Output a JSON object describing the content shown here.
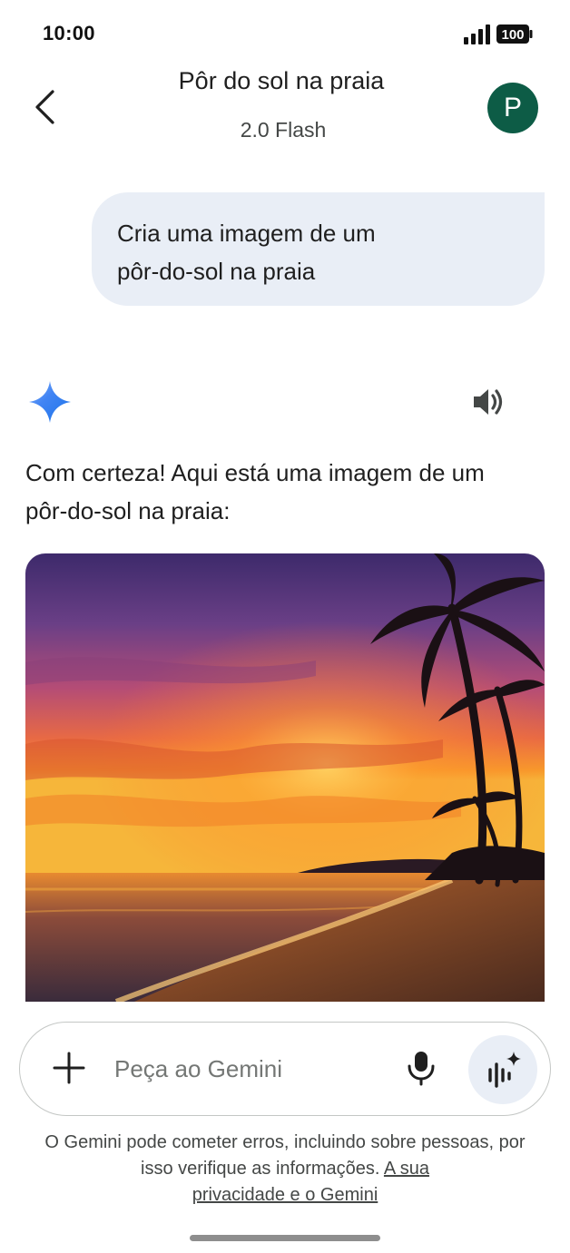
{
  "status_bar": {
    "time": "10:00",
    "battery": "100"
  },
  "header": {
    "title": "Pôr do sol na praia",
    "model": "2.0 Flash",
    "avatar_initial": "P"
  },
  "user_message": {
    "line1": "Cria uma imagem de um",
    "line2": "pôr-do-sol na praia"
  },
  "response": {
    "line1": "Com certeza! Aqui está uma imagem de um",
    "line2": "pôr-do-sol na praia:"
  },
  "input": {
    "placeholder": "Peça ao Gemini"
  },
  "footer": {
    "disclaimer_part1": "O Gemini pode cometer erros, incluindo sobre",
    "disclaimer_part2": "pessoas, por isso verifique as informações.",
    "privacy_link_part1": "A sua",
    "privacy_link_part2": "privacidade e o Gemini"
  },
  "colors": {
    "avatar": "#0d5c46",
    "bubble": "#e9eef6",
    "accent_blue": "#4285f4"
  },
  "icons": [
    "back-arrow-icon",
    "signal-icon",
    "battery-icon",
    "gemini-spark-icon",
    "speaker-icon",
    "plus-icon",
    "mic-icon",
    "live-mode-icon"
  ]
}
